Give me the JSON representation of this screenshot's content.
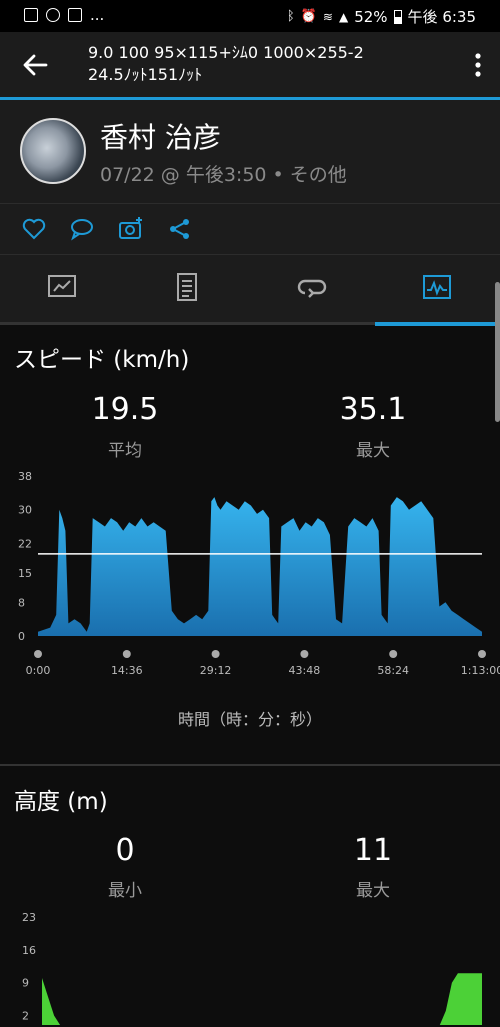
{
  "status_bar": {
    "left_icons": [
      "image-icon",
      "sync-icon",
      "news-icon"
    ],
    "ellipsis": "...",
    "battery": "52%",
    "time": "午後 6:35"
  },
  "app_bar": {
    "title_line1": "9.0 100 95×115+ｼﾑ0 1000×255-2",
    "title_line2": "24.5ﾉｯﾄ151ﾉｯﾄ"
  },
  "header": {
    "user_name": "香村 治彦",
    "meta": "07/22 @ 午後3:50 • その他"
  },
  "actions": [
    "like-icon",
    "comment-icon",
    "add-photo-icon",
    "share-icon"
  ],
  "tabs": [
    {
      "name": "overview",
      "icon": "overview-icon",
      "selected": false
    },
    {
      "name": "details",
      "icon": "details-icon",
      "selected": false
    },
    {
      "name": "laps",
      "icon": "laps-icon",
      "selected": false
    },
    {
      "name": "charts",
      "icon": "chart-icon",
      "selected": true
    }
  ],
  "speed": {
    "title": "スピード (km/h)",
    "avg_value": "19.5",
    "avg_label": "平均",
    "max_value": "35.1",
    "max_label": "最大"
  },
  "elevation": {
    "title": "高度 (m)",
    "min_value": "0",
    "min_label": "最小",
    "max_value": "11",
    "max_label": "最大"
  },
  "x_axis_caption": "時間（時：分：秒）",
  "colors": {
    "accent": "#1e9ad6",
    "speed_fill": "#1e8fd0",
    "elevation_fill": "#4cd137",
    "background": "#0d0d0d",
    "panel": "#1c1c1c"
  },
  "chart_data": [
    {
      "type": "area",
      "title": "スピード (km/h)",
      "xlabel": "時間（時：分：秒）",
      "ylabel": "",
      "x_ticks": [
        "0:00",
        "14:36",
        "29:12",
        "43:48",
        "58:24",
        "1:13:00"
      ],
      "y_ticks": [
        "0",
        "8",
        "15",
        "22",
        "30",
        "38"
      ],
      "ylim": [
        0,
        38
      ],
      "xlim_minutes": [
        0,
        73
      ],
      "average_line": 19.5,
      "x_minutes": [
        0,
        2,
        3,
        3.5,
        4,
        4.5,
        5,
        6,
        7,
        8,
        8.5,
        9,
        10,
        11,
        12,
        13,
        14,
        15,
        16,
        17,
        18,
        19,
        20,
        21,
        22,
        23,
        24,
        25,
        26,
        27,
        28,
        28.5,
        29,
        29.5,
        30,
        31,
        32,
        33,
        34,
        35,
        36,
        37,
        38,
        38.5,
        39,
        39.5,
        40,
        41,
        42,
        43,
        44,
        45,
        46,
        47,
        48,
        49,
        50,
        51,
        52,
        53,
        54,
        55,
        56,
        56.5,
        57,
        57.5,
        58,
        59,
        60,
        61,
        62,
        63,
        64,
        65,
        66,
        67,
        68,
        69,
        70,
        71,
        72,
        73
      ],
      "values": [
        1,
        2,
        5,
        30,
        28,
        25,
        3,
        4,
        3,
        1,
        3,
        28,
        27,
        26,
        28,
        27,
        25,
        27,
        26,
        28,
        26,
        27,
        26,
        25,
        6,
        4,
        3,
        4,
        5,
        4,
        6,
        32,
        33,
        31,
        30,
        32,
        31,
        30,
        32,
        31,
        29,
        30,
        28,
        5,
        4,
        3,
        26,
        27,
        28,
        25,
        27,
        26,
        28,
        27,
        24,
        4,
        3,
        26,
        28,
        27,
        26,
        28,
        25,
        5,
        4,
        3,
        31,
        33,
        32,
        30,
        31,
        32,
        30,
        28,
        7,
        8,
        6,
        5,
        4,
        3,
        2,
        1
      ]
    },
    {
      "type": "area",
      "title": "高度 (m)",
      "y_ticks": [
        "2",
        "9",
        "16",
        "23"
      ],
      "ylim": [
        0,
        23
      ],
      "xlim_minutes": [
        0,
        73
      ],
      "x_minutes": [
        0,
        1,
        2,
        3,
        10,
        20,
        30,
        40,
        50,
        60,
        66,
        67,
        68,
        69,
        70,
        71,
        72,
        73
      ],
      "values": [
        10,
        6,
        2,
        0,
        0,
        0,
        0,
        0,
        0,
        0,
        0,
        3,
        9,
        11,
        11,
        11,
        11,
        11
      ]
    }
  ]
}
